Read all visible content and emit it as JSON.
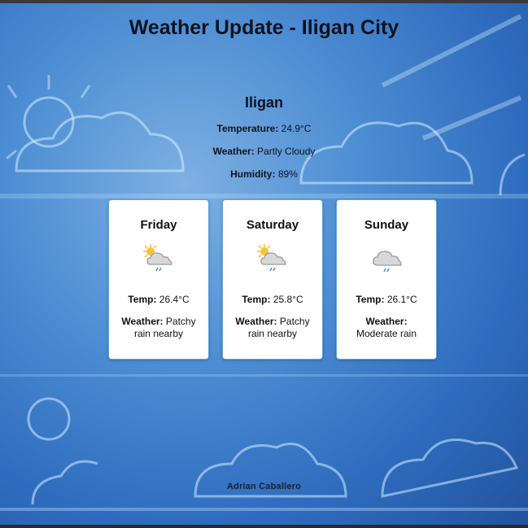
{
  "header": {
    "title": "Weather Update - Iligan City"
  },
  "current": {
    "city": "Iligan",
    "temperature_label": "Temperature:",
    "temperature_value": "24.9°C",
    "weather_label": "Weather:",
    "weather_value": "Partly Cloudy",
    "humidity_label": "Humidity:",
    "humidity_value": "89%"
  },
  "forecast": [
    {
      "day": "Friday",
      "temp_label": "Temp:",
      "temp": "26.4°C",
      "weather_label": "Weather:",
      "weather": "Patchy rain nearby",
      "icon": "sun-cloud-rain-icon"
    },
    {
      "day": "Saturday",
      "temp_label": "Temp:",
      "temp": "25.8°C",
      "weather_label": "Weather:",
      "weather": "Patchy rain nearby",
      "icon": "sun-cloud-rain-icon"
    },
    {
      "day": "Sunday",
      "temp_label": "Temp:",
      "temp": "26.1°C",
      "weather_label": "Weather:",
      "weather": "Moderate rain",
      "icon": "cloud-rain-icon"
    }
  ],
  "footer": {
    "author": "Adrian Caballero"
  },
  "colors": {
    "background": "#4f8fd4",
    "card": "#ffffff",
    "card_border": "#5fa4d8",
    "rain": "#3b8fe0",
    "sun": "#f5c33b"
  }
}
